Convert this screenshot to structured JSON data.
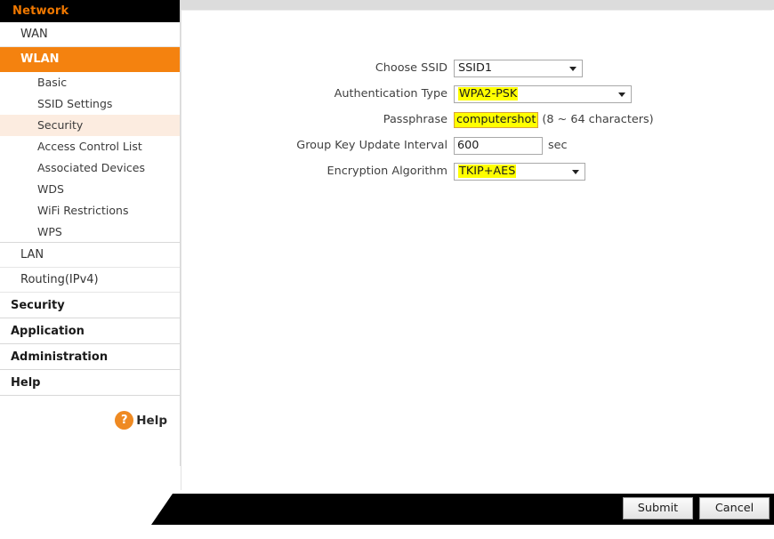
{
  "sidebar": {
    "header": "Network",
    "top_items": [
      {
        "label": "WAN",
        "state": "normal"
      },
      {
        "label": "WLAN",
        "state": "active"
      }
    ],
    "wlan_subitems": [
      {
        "label": "Basic",
        "selected": false
      },
      {
        "label": "SSID Settings",
        "selected": false
      },
      {
        "label": "Security",
        "selected": true
      },
      {
        "label": "Access Control List",
        "selected": false
      },
      {
        "label": "Associated Devices",
        "selected": false
      },
      {
        "label": "WDS",
        "selected": false
      },
      {
        "label": "WiFi Restrictions",
        "selected": false
      },
      {
        "label": "WPS",
        "selected": false
      }
    ],
    "lan_label": "LAN",
    "routing_label": "Routing(IPv4)",
    "sections": [
      {
        "label": "Security"
      },
      {
        "label": "Application"
      },
      {
        "label": "Administration"
      },
      {
        "label": "Help"
      }
    ],
    "help_widget": {
      "icon": "question-mark-circle-icon",
      "glyph": "?",
      "label": "Help"
    }
  },
  "form": {
    "rows": [
      {
        "label": "Choose SSID",
        "type": "select",
        "value": "SSID1",
        "highlighted": false,
        "suffix": ""
      },
      {
        "label": "Authentication Type",
        "type": "select",
        "value": "WPA2-PSK",
        "highlighted": true,
        "suffix": ""
      },
      {
        "label": "Passphrase",
        "type": "text",
        "value": "computershot",
        "highlighted": true,
        "suffix": "(8 ~ 64 characters)"
      },
      {
        "label": "Group Key Update Interval",
        "type": "text",
        "value": "600",
        "highlighted": false,
        "suffix": "sec"
      },
      {
        "label": "Encryption Algorithm",
        "type": "select",
        "value": "TKIP+AES",
        "highlighted": true,
        "suffix": ""
      }
    ]
  },
  "footer": {
    "submit_label": "Submit",
    "cancel_label": "Cancel"
  },
  "colors": {
    "accent_orange": "#f4820f",
    "header_orange_text": "#f07800",
    "highlight_yellow": "#ffff00",
    "selected_subitem": "#fcece0",
    "footer_black": "#000000"
  }
}
